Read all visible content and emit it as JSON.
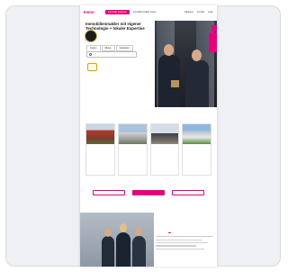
{
  "nav": {
    "logo": "Immo",
    "cta_label": "Immobilie bewerten",
    "links": [
      "Immobilienmakler finden",
      "Ratgeber",
      "Kontakt",
      "Login"
    ]
  },
  "hero": {
    "title": "Immobilienmakler mit eigener Technologie + lokaler Expertise",
    "subtitle": "",
    "badge": "",
    "tabs": [
      "Kaufen",
      "Mieten",
      "Verkaufen"
    ],
    "search_placeholder": ""
  },
  "trust": {
    "badge1": "",
    "badge2": ""
  },
  "listings_section": {
    "title": "",
    "items": [
      {
        "title": "",
        "details": "",
        "link": ""
      },
      {
        "title": "",
        "details": "",
        "link": ""
      },
      {
        "title": "",
        "details": "",
        "link": ""
      },
      {
        "title": "",
        "details": "",
        "link": ""
      }
    ]
  },
  "ctas": [
    "",
    "",
    ""
  ],
  "team": {
    "award": "",
    "badge": ""
  },
  "colors": {
    "accent": "#e6007e",
    "background": "#eef0f4"
  }
}
